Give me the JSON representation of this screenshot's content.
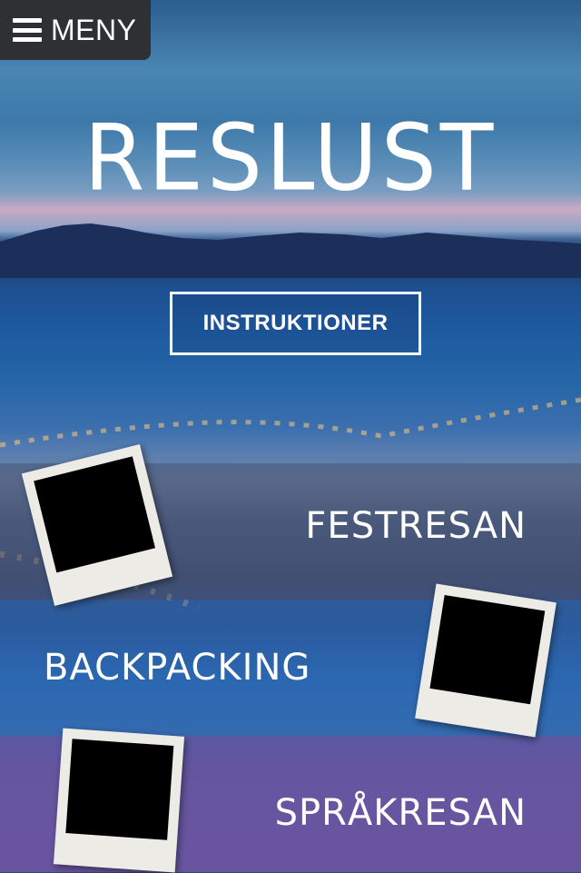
{
  "menu": {
    "label": "MENY",
    "icon": "hamburger-menu-icon"
  },
  "site": {
    "title": "RESLUST"
  },
  "instructions_button": {
    "label": "INSTRUKTIONER"
  },
  "categories": [
    {
      "label": "FESTRESAN"
    },
    {
      "label": "BACKPACKING"
    },
    {
      "label": "SPRÅKRESAN"
    }
  ],
  "colors": {
    "menu_bg": "#2f3033",
    "text": "#ffffff",
    "band_festresan": "#46557a",
    "band_backpacking": "#286ebe",
    "band_sprakresan": "#6e50a0",
    "polaroid_frame": "#ecebe6"
  }
}
